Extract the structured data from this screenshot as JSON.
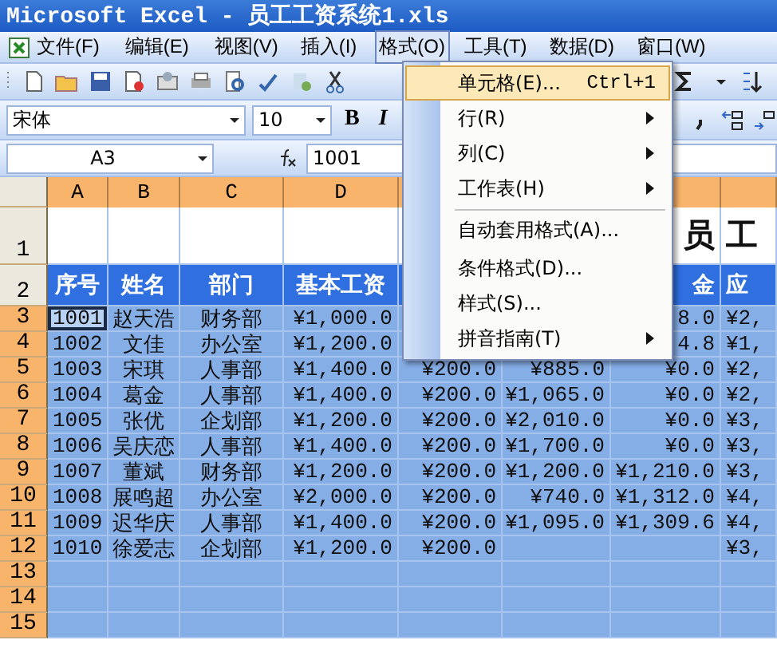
{
  "window": {
    "title": "Microsoft Excel - 员工工资系统1.xls"
  },
  "menu_bar": [
    {
      "label": "文件(F)",
      "selected": false
    },
    {
      "label": "编辑(E)",
      "selected": false
    },
    {
      "label": "视图(V)",
      "selected": false
    },
    {
      "label": "插入(I)",
      "selected": false
    },
    {
      "label": "格式(O)",
      "selected": true
    },
    {
      "label": "工具(T)",
      "selected": false
    },
    {
      "label": "数据(D)",
      "selected": false
    },
    {
      "label": "窗口(W)",
      "selected": false
    }
  ],
  "open_menu": [
    {
      "label": "单元格(E)...",
      "shortcut": "Ctrl+1",
      "submenu": false,
      "selected": true,
      "separator_before": false
    },
    {
      "label": "行(R)",
      "submenu": true,
      "selected": false,
      "separator_before": false
    },
    {
      "label": "列(C)",
      "submenu": true,
      "selected": false,
      "separator_before": false
    },
    {
      "label": "工作表(H)",
      "submenu": true,
      "selected": false,
      "separator_before": false
    },
    {
      "label": "自动套用格式(A)...",
      "submenu": false,
      "selected": false,
      "separator_before": true
    },
    {
      "label": "条件格式(D)...",
      "submenu": false,
      "selected": false,
      "separator_before": false
    },
    {
      "label": "样式(S)...",
      "submenu": false,
      "selected": false,
      "separator_before": false
    },
    {
      "label": "拼音指南(T)",
      "submenu": true,
      "selected": false,
      "separator_before": false
    }
  ],
  "formatting_toolbar": {
    "font": "宋体",
    "size": "10",
    "bold": "B",
    "italic": "I"
  },
  "formula_bar": {
    "name_box": "A3",
    "formula": "1001"
  },
  "sheet": {
    "columns": [
      "A",
      "B",
      "C",
      "D"
    ],
    "rows": [
      {
        "number": "1",
        "selected": false,
        "cursor": false,
        "cells": [
          null,
          null,
          null,
          null,
          null,
          null,
          "员",
          "工"
        ]
      },
      {
        "number": "2",
        "selected": false,
        "cursor": false,
        "cells": [
          "序号",
          "姓名",
          "部门",
          "基本工资",
          null,
          null,
          "金",
          "应"
        ]
      },
      {
        "number": "3",
        "selected": true,
        "cursor": true,
        "cells": [
          "1001",
          "赵天浩",
          "财务部",
          "¥1,000.0",
          null,
          null,
          "8.0",
          "¥2,"
        ]
      },
      {
        "number": "4",
        "selected": true,
        "cursor": false,
        "cells": [
          "1002",
          "文佳",
          "办公室",
          "¥1,200.0",
          null,
          null,
          "4.8",
          "¥1,"
        ]
      },
      {
        "number": "5",
        "selected": true,
        "cursor": false,
        "cells": [
          "1003",
          "宋琪",
          "人事部",
          "¥1,400.0",
          "¥200.0",
          "¥885.0",
          "¥0.0",
          "¥2,"
        ]
      },
      {
        "number": "6",
        "selected": true,
        "cursor": false,
        "cells": [
          "1004",
          "葛金",
          "人事部",
          "¥1,400.0",
          "¥200.0",
          "¥1,065.0",
          "¥0.0",
          "¥2,"
        ]
      },
      {
        "number": "7",
        "selected": true,
        "cursor": false,
        "cells": [
          "1005",
          "张优",
          "企划部",
          "¥1,200.0",
          "¥200.0",
          "¥2,010.0",
          "¥0.0",
          "¥3,"
        ]
      },
      {
        "number": "8",
        "selected": true,
        "cursor": false,
        "cells": [
          "1006",
          "吴庆恋",
          "人事部",
          "¥1,400.0",
          "¥200.0",
          "¥1,700.0",
          "¥0.0",
          "¥3,"
        ]
      },
      {
        "number": "9",
        "selected": true,
        "cursor": false,
        "cells": [
          "1007",
          "董斌",
          "财务部",
          "¥1,200.0",
          "¥200.0",
          "¥1,200.0",
          "¥1,210.0",
          "¥3,"
        ]
      },
      {
        "number": "10",
        "selected": true,
        "cursor": false,
        "cells": [
          "1008",
          "展鸣超",
          "办公室",
          "¥2,000.0",
          "¥200.0",
          "¥740.0",
          "¥1,312.0",
          "¥4,"
        ]
      },
      {
        "number": "11",
        "selected": true,
        "cursor": false,
        "cells": [
          "1009",
          "迟华庆",
          "人事部",
          "¥1,400.0",
          "¥200.0",
          "¥1,095.0",
          "¥1,309.6",
          "¥4,"
        ]
      },
      {
        "number": "12",
        "selected": true,
        "cursor": false,
        "cells": [
          "1010",
          "徐爱志",
          "企划部",
          "¥1,200.0",
          "¥200.0",
          null,
          null,
          "¥3,"
        ]
      },
      {
        "number": "13",
        "selected": true,
        "cursor": false,
        "cells": [
          null,
          null,
          null,
          null,
          null,
          null,
          null,
          null
        ]
      },
      {
        "number": "14",
        "selected": true,
        "cursor": false,
        "cells": [
          null,
          null,
          null,
          null,
          null,
          null,
          null,
          null
        ]
      },
      {
        "number": "15",
        "selected": true,
        "cursor": false,
        "cells": [
          null,
          null,
          null,
          null,
          null,
          null,
          null,
          null
        ]
      }
    ]
  }
}
